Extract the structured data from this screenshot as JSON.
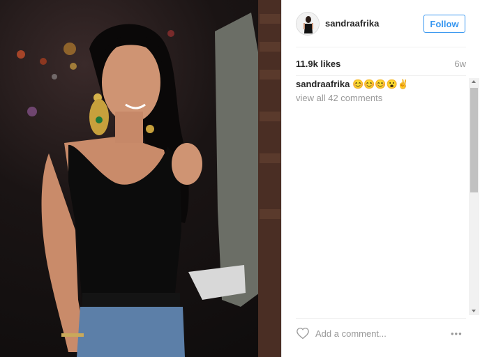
{
  "post": {
    "username": "sandraafrika",
    "follow_label": "Follow",
    "likes": "11.9k likes",
    "time_ago": "6w",
    "caption_user": "sandraafrika",
    "caption_text": "😊😊😊😮✌",
    "view_all": "view all 42 comments",
    "add_comment_placeholder": "Add a comment...",
    "more_label": "•••"
  },
  "colors": {
    "accent": "#3897f0",
    "text": "#262626",
    "muted": "#999999"
  },
  "icons": {
    "avatar": "profile-avatar",
    "like": "heart-icon",
    "more": "more-options-icon"
  }
}
